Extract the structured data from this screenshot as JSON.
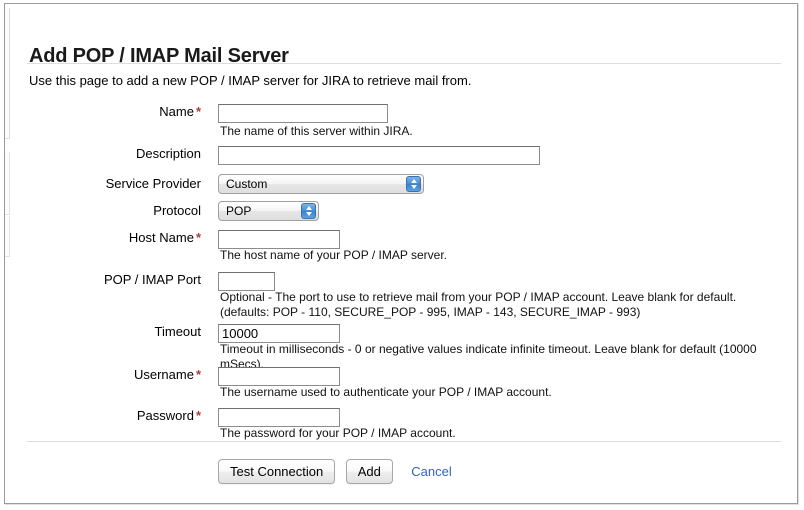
{
  "page": {
    "title": "Add POP / IMAP Mail Server",
    "description": "Use this page to add a new POP / IMAP server for JIRA to retrieve mail from.",
    "required_marker": "*"
  },
  "form": {
    "fields": [
      {
        "key": "name",
        "label": "Name",
        "required": true,
        "control": "text",
        "value": "",
        "hint": "The name of this server within JIRA."
      },
      {
        "key": "description",
        "label": "Description",
        "required": false,
        "control": "text",
        "value": "",
        "hint": ""
      },
      {
        "key": "service_provider",
        "label": "Service Provider",
        "required": false,
        "control": "select",
        "value": "Custom",
        "hint": ""
      },
      {
        "key": "protocol",
        "label": "Protocol",
        "required": false,
        "control": "select",
        "value": "POP",
        "hint": ""
      },
      {
        "key": "host_name",
        "label": "Host Name",
        "required": true,
        "control": "text",
        "value": "",
        "hint": "The host name of your POP / IMAP server."
      },
      {
        "key": "port",
        "label": "POP / IMAP Port",
        "required": false,
        "control": "text",
        "value": "",
        "hint": "Optional - The port to use to retrieve mail from your POP / IMAP account. Leave blank for default. (defaults: POP - 110, SECURE_POP - 995, IMAP - 143, SECURE_IMAP - 993)"
      },
      {
        "key": "timeout",
        "label": "Timeout",
        "required": false,
        "control": "text",
        "value": "10000",
        "hint": "Timeout in milliseconds - 0 or negative values indicate infinite timeout. Leave blank for default (10000 mSecs)."
      },
      {
        "key": "username",
        "label": "Username",
        "required": true,
        "control": "text",
        "value": "",
        "hint": "The username used to authenticate your POP / IMAP account."
      },
      {
        "key": "password",
        "label": "Password",
        "required": true,
        "control": "password",
        "value": "",
        "hint": "The password for your POP / IMAP account."
      }
    ]
  },
  "footer": {
    "test_connection_label": "Test Connection",
    "add_label": "Add",
    "cancel_label": "Cancel"
  },
  "colors": {
    "required_star": "#a24040",
    "link": "#3366bb",
    "rule": "#dddddd",
    "stepper_blue": "#4a8fd4"
  }
}
